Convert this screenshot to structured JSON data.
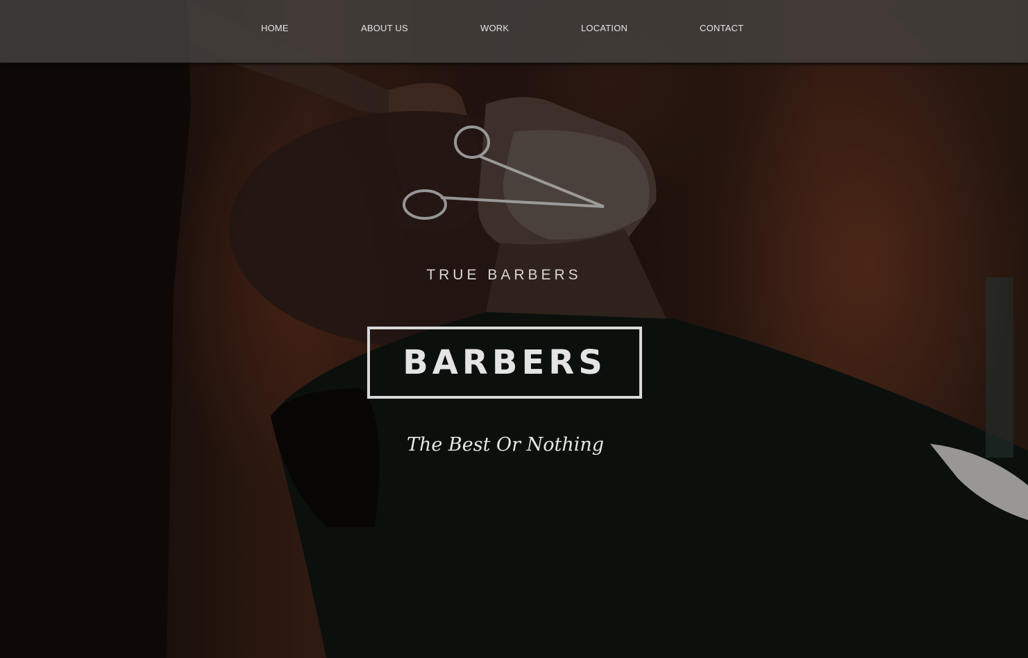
{
  "nav": {
    "items": [
      {
        "label": "HOME"
      },
      {
        "label": "ABOUT US"
      },
      {
        "label": "WORK"
      },
      {
        "label": "LOCATION"
      },
      {
        "label": "CONTACT"
      }
    ]
  },
  "hero": {
    "eyebrow": "TRUE BARBERS",
    "title": "BARBERS",
    "tagline": "The Best Or Nothing"
  },
  "colors": {
    "nav_background": "#464240",
    "text": "#e6e4e2",
    "title_border": "#d9d9d9",
    "background_dark": "#120c0a"
  }
}
